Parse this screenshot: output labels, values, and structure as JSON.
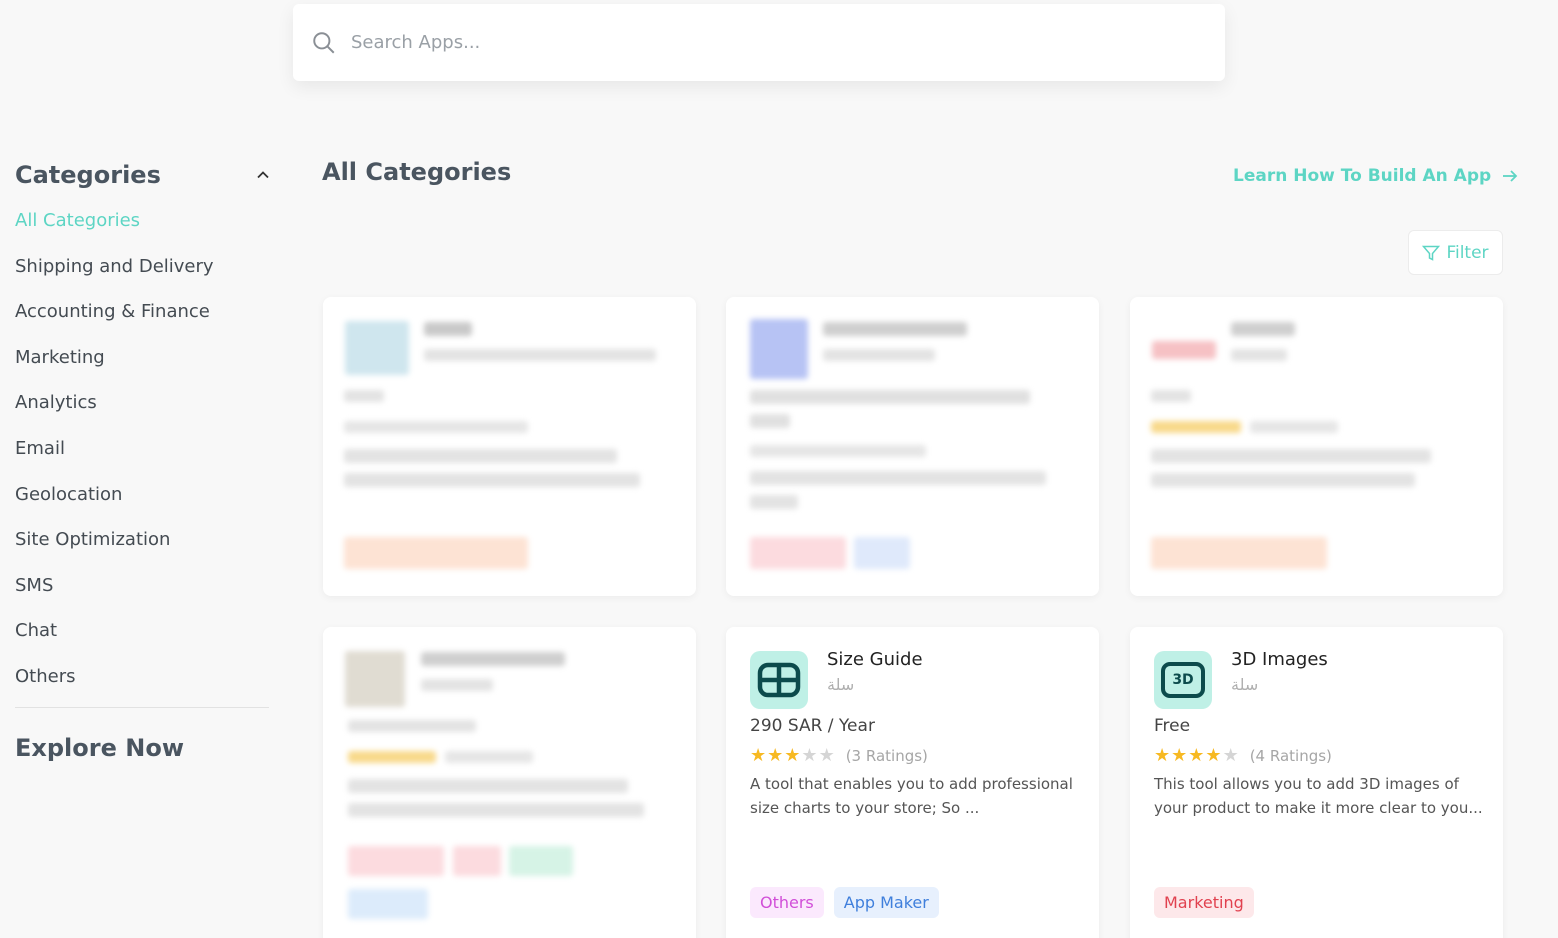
{
  "search": {
    "placeholder": "Search Apps..."
  },
  "sidebar": {
    "title": "Categories",
    "items": [
      {
        "label": "All Categories",
        "active": true
      },
      {
        "label": "Shipping and Delivery"
      },
      {
        "label": "Accounting & Finance"
      },
      {
        "label": "Marketing"
      },
      {
        "label": "Analytics"
      },
      {
        "label": "Email"
      },
      {
        "label": "Geolocation"
      },
      {
        "label": "Site Optimization"
      },
      {
        "label": "SMS"
      },
      {
        "label": "Chat"
      },
      {
        "label": "Others"
      }
    ],
    "explore_label": "Explore Now"
  },
  "main": {
    "title": "All Categories",
    "learn_link": "Learn How To Build An App",
    "filter_label": "Filter"
  },
  "apps": [
    {
      "name": "Size Guide",
      "vendor": "سلة",
      "price": "290 SAR / Year",
      "rating": 3,
      "ratings_text": "(3 Ratings)",
      "description": "A tool that enables you to add professional size charts to your store; So ...",
      "tags": [
        {
          "label": "Others",
          "color": "#d14fd8",
          "bg": "#fbe9fd"
        },
        {
          "label": "App Maker",
          "color": "#3f7fdc",
          "bg": "#e7f0fd"
        }
      ],
      "icon": "grid-icon"
    },
    {
      "name": "3D Images",
      "vendor": "سلة",
      "price": "Free",
      "rating": 4,
      "ratings_text": "(4 Ratings)",
      "description": "This tool allows you to add 3D images of your product to make it more clear to you...",
      "tags": [
        {
          "label": "Marketing",
          "color": "#e1414f",
          "bg": "#fde8ea"
        }
      ],
      "icon": "3d-icon",
      "icon_text": "3D"
    }
  ],
  "colors": {
    "accent": "#5dd5c4",
    "star": "#f7b922"
  }
}
